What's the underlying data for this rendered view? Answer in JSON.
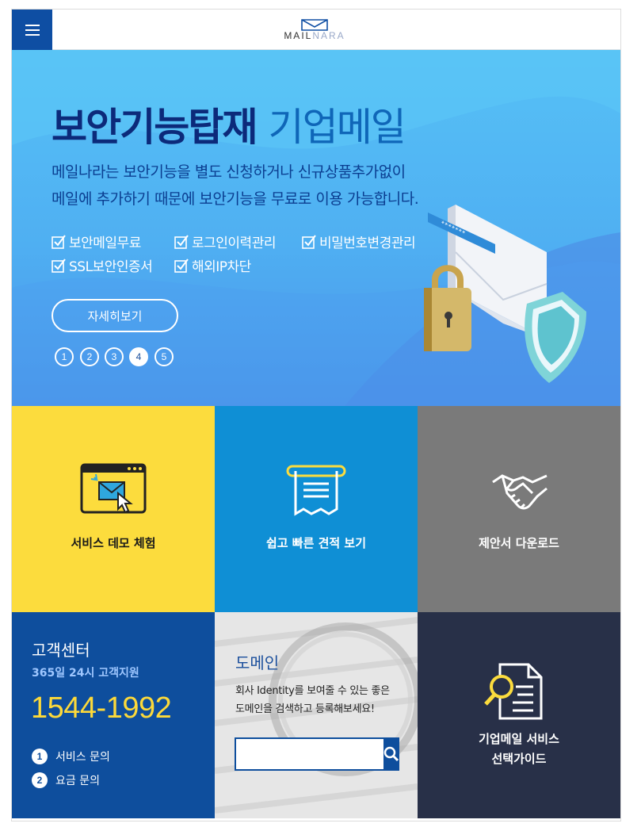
{
  "header": {
    "logo_text_dark": "MAIL",
    "logo_text_light": "NARA",
    "brand_color": "#0e4ea3"
  },
  "hero": {
    "title_main": "보안기능탑재",
    "title_accent": "기업메일",
    "description": [
      "메일나라는 보안기능을 별도 신청하거나 신규상품추가없이",
      "메일에 추가하기 때문에 보안기능을 무료로 이용 가능합니다."
    ],
    "features": [
      "보안메일무료",
      "로그인이력관리",
      "비밀번호변경관리",
      "SSL보안인증서",
      "해외IP차단"
    ],
    "more_button": "자세히보기",
    "slides": [
      "1",
      "2",
      "3",
      "4",
      "5"
    ],
    "active_slide": 4
  },
  "tiles": {
    "demo": {
      "label": "서비스 데모 체험",
      "color": "#fcdc3d"
    },
    "quote": {
      "label": "쉽고 빠른 견적 보기",
      "color": "#0f8fd5"
    },
    "proposal": {
      "label": "제안서 다운로드",
      "color": "#7a7a7a"
    }
  },
  "customer_center": {
    "title": "고객센터",
    "subtitle": "365일 24시 고객지원",
    "phone": "1544-1992",
    "items": [
      {
        "num": "1",
        "label": "서비스 문의"
      },
      {
        "num": "2",
        "label": "요금 문의"
      }
    ],
    "phone_color": "#fcd93a"
  },
  "domain": {
    "title": "도메인",
    "description": [
      "회사 Identity를 보여줄 수 있는 좋은",
      "도메인을 검색하고 등록해보세요!"
    ],
    "search_placeholder": ""
  },
  "guide": {
    "label_line1": "기업메일 서비스",
    "label_line2": "선택가이드"
  },
  "icons": [
    "menu-icon",
    "mail-logo-icon",
    "checkbox-icon",
    "browser-mail-icon",
    "receipt-icon",
    "handshake-icon",
    "search-icon",
    "document-magnifier-icon",
    "lock-icon",
    "shield-icon",
    "envelope-icon"
  ]
}
